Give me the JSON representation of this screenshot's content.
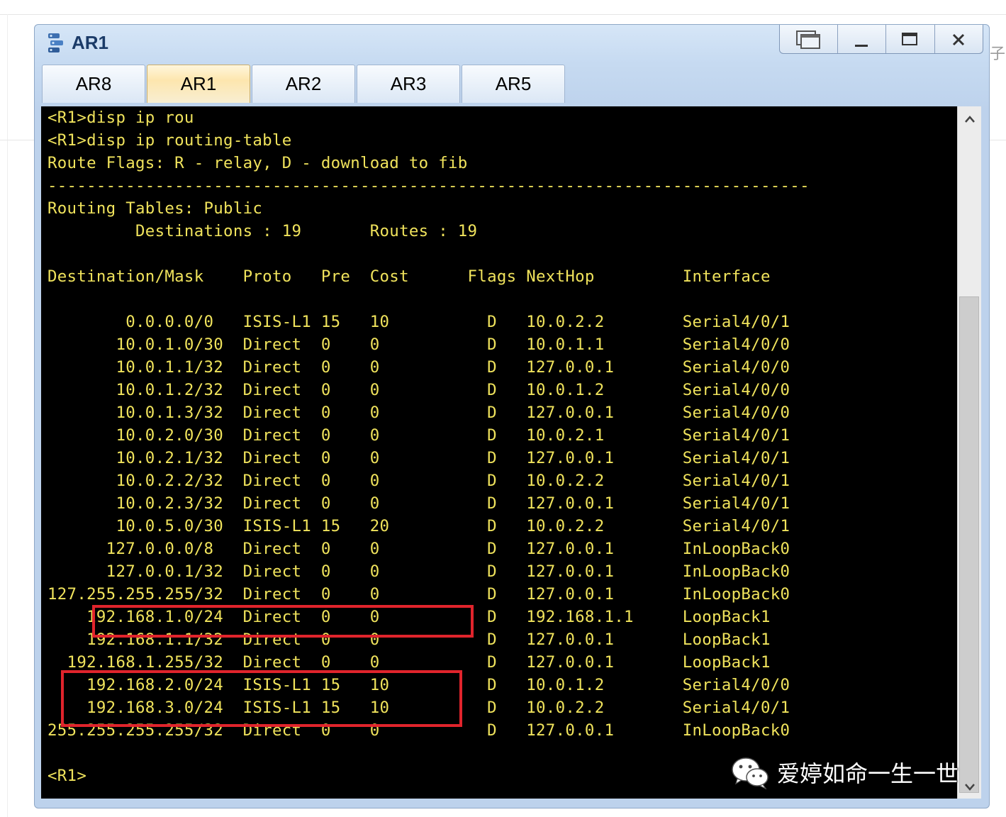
{
  "window": {
    "title": "AR1",
    "controls": [
      "restore",
      "minimize",
      "maximize",
      "close"
    ]
  },
  "tabs": [
    {
      "label": "AR8",
      "active": false
    },
    {
      "label": "AR1",
      "active": true
    },
    {
      "label": "AR2",
      "active": false
    },
    {
      "label": "AR3",
      "active": false
    },
    {
      "label": "AR5",
      "active": false
    }
  ],
  "terminal": {
    "text_color": "#f0e35c",
    "background": "#000000",
    "lines": [
      "<R1>disp ip rou",
      "<R1>disp ip routing-table",
      "Route Flags: R - relay, D - download to fib",
      "------------------------------------------------------------------------------",
      "Routing Tables: Public",
      "         Destinations : 19       Routes : 19",
      "",
      "Destination/Mask    Proto   Pre  Cost      Flags NextHop         Interface",
      "",
      "        0.0.0.0/0   ISIS-L1 15   10          D   10.0.2.2        Serial4/0/1",
      "       10.0.1.0/30  Direct  0    0           D   10.0.1.1        Serial4/0/0",
      "       10.0.1.1/32  Direct  0    0           D   127.0.0.1       Serial4/0/0",
      "       10.0.1.2/32  Direct  0    0           D   10.0.1.2        Serial4/0/0",
      "       10.0.1.3/32  Direct  0    0           D   127.0.0.1       Serial4/0/0",
      "       10.0.2.0/30  Direct  0    0           D   10.0.2.1        Serial4/0/1",
      "       10.0.2.1/32  Direct  0    0           D   127.0.0.1       Serial4/0/1",
      "       10.0.2.2/32  Direct  0    0           D   10.0.2.2        Serial4/0/1",
      "       10.0.2.3/32  Direct  0    0           D   127.0.0.1       Serial4/0/1",
      "       10.0.5.0/30  ISIS-L1 15   20          D   10.0.2.2        Serial4/0/1",
      "      127.0.0.0/8   Direct  0    0           D   127.0.0.1       InLoopBack0",
      "      127.0.0.1/32  Direct  0    0           D   127.0.0.1       InLoopBack0",
      "127.255.255.255/32  Direct  0    0           D   127.0.0.1       InLoopBack0",
      "    192.168.1.0/24  Direct  0    0           D   192.168.1.1     LoopBack1",
      "    192.168.1.1/32  Direct  0    0           D   127.0.0.1       LoopBack1",
      "  192.168.1.255/32  Direct  0    0           D   127.0.0.1       LoopBack1",
      "    192.168.2.0/24  ISIS-L1 15   10          D   10.0.1.2        Serial4/0/0",
      "    192.168.3.0/24  ISIS-L1 15   10          D   10.0.2.2        Serial4/0/1",
      "255.255.255.255/32  Direct  0    0           D   127.0.0.1       InLoopBack0",
      "",
      "<R1>"
    ],
    "highlight_color": "#e0242c"
  },
  "watermark": {
    "text": "爱婷如命一生一世",
    "icon": "wechat-icon"
  },
  "background_fragment": "子"
}
